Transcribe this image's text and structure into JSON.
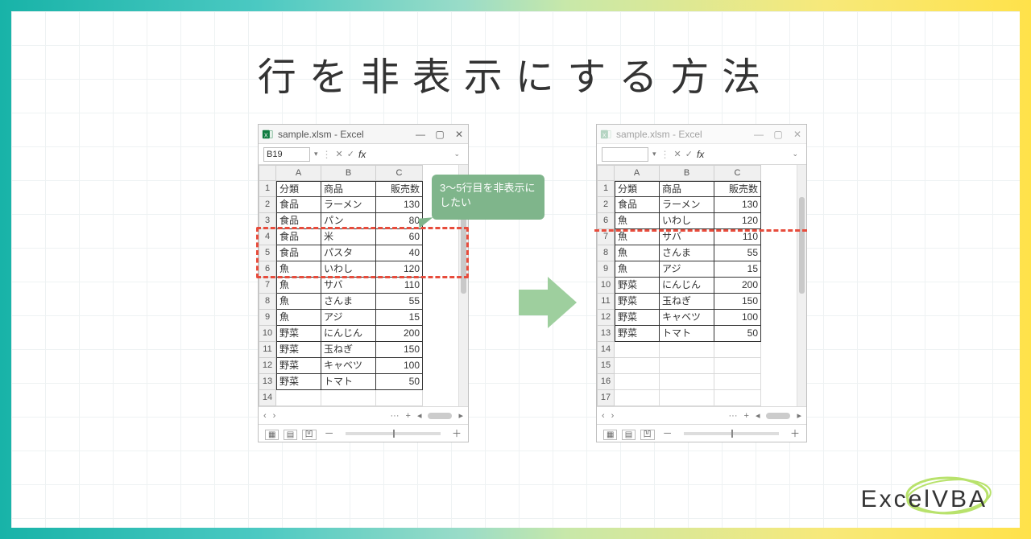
{
  "title": {
    "pre": "行を",
    "highlight": "非表示",
    "post": "にする方法"
  },
  "brand": "ExcelVBA",
  "bubble_text": "3～5行目を非表示にしたい",
  "left_window": {
    "file_title": "sample.xlsm - Excel",
    "name_box": "B19",
    "fx_label": "fx",
    "columns": {
      "a": "A",
      "b": "B",
      "c": "C"
    },
    "rows": [
      {
        "n": "1",
        "a": "分類",
        "b": "商品",
        "c": "販売数",
        "header": true
      },
      {
        "n": "2",
        "a": "食品",
        "b": "ラーメン",
        "c": "130"
      },
      {
        "n": "3",
        "a": "食品",
        "b": "パン",
        "c": "80"
      },
      {
        "n": "4",
        "a": "食品",
        "b": "米",
        "c": "60"
      },
      {
        "n": "5",
        "a": "食品",
        "b": "パスタ",
        "c": "40"
      },
      {
        "n": "6",
        "a": "魚",
        "b": "いわし",
        "c": "120"
      },
      {
        "n": "7",
        "a": "魚",
        "b": "サバ",
        "c": "110"
      },
      {
        "n": "8",
        "a": "魚",
        "b": "さんま",
        "c": "55"
      },
      {
        "n": "9",
        "a": "魚",
        "b": "アジ",
        "c": "15"
      },
      {
        "n": "10",
        "a": "野菜",
        "b": "にんじん",
        "c": "200"
      },
      {
        "n": "11",
        "a": "野菜",
        "b": "玉ねぎ",
        "c": "150"
      },
      {
        "n": "12",
        "a": "野菜",
        "b": "キャベツ",
        "c": "100"
      },
      {
        "n": "13",
        "a": "野菜",
        "b": "トマト",
        "c": "50"
      }
    ],
    "empty_rows": [
      "14"
    ]
  },
  "right_window": {
    "file_title": "sample.xlsm - Excel",
    "name_box": "",
    "fx_label": "fx",
    "columns": {
      "a": "A",
      "b": "B",
      "c": "C"
    },
    "rows": [
      {
        "n": "1",
        "a": "分類",
        "b": "商品",
        "c": "販売数",
        "header": true
      },
      {
        "n": "2",
        "a": "食品",
        "b": "ラーメン",
        "c": "130"
      },
      {
        "n": "6",
        "a": "魚",
        "b": "いわし",
        "c": "120"
      },
      {
        "n": "7",
        "a": "魚",
        "b": "サバ",
        "c": "110"
      },
      {
        "n": "8",
        "a": "魚",
        "b": "さんま",
        "c": "55"
      },
      {
        "n": "9",
        "a": "魚",
        "b": "アジ",
        "c": "15"
      },
      {
        "n": "10",
        "a": "野菜",
        "b": "にんじん",
        "c": "200"
      },
      {
        "n": "11",
        "a": "野菜",
        "b": "玉ねぎ",
        "c": "150"
      },
      {
        "n": "12",
        "a": "野菜",
        "b": "キャベツ",
        "c": "100"
      },
      {
        "n": "13",
        "a": "野菜",
        "b": "トマト",
        "c": "50"
      }
    ],
    "empty_rows": [
      "14",
      "15",
      "16",
      "17"
    ]
  },
  "tabbar_icons": {
    "prev": "‹",
    "next": "›",
    "more": "···",
    "plus": "+"
  },
  "win_ctrl": {
    "min": "—",
    "max": "▢",
    "close": "✕"
  },
  "statusbar": {
    "minus": "－",
    "plus": "＋"
  }
}
